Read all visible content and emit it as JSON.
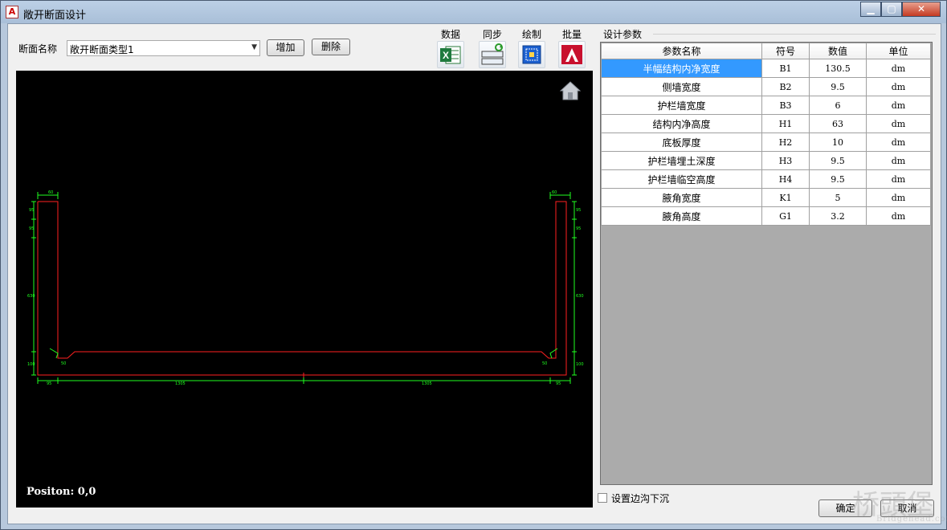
{
  "window": {
    "title": "敞开断面设计",
    "app_icon": "autocad-icon",
    "controls": {
      "minimize": "▁",
      "maximize": "▢",
      "close": "✕"
    }
  },
  "section": {
    "name_label": "断面名称",
    "selected": "敞开断面类型1",
    "add_label": "增加",
    "delete_label": "删除"
  },
  "tools": [
    {
      "label": "数据",
      "icon": "excel-icon"
    },
    {
      "label": "同步",
      "icon": "sync-icon"
    },
    {
      "label": "绘制",
      "icon": "draw-icon"
    },
    {
      "label": "批量",
      "icon": "autocad-icon"
    }
  ],
  "canvas": {
    "position_text": "Positon: 0,0",
    "home_icon": "home-icon",
    "dims": {
      "top_left": "60",
      "top_right": "60",
      "left_upper": "95",
      "left_mid": "95",
      "left_long": "630",
      "left_bottom": "100",
      "right_upper": "95",
      "right_mid": "95",
      "right_long": "630",
      "right_bottom": "100",
      "haunch_left": "50",
      "haunch_right": "50",
      "bottom_left_small": "95",
      "bottom_left_span": "1305",
      "bottom_right_span": "1305",
      "bottom_right_small": "95"
    }
  },
  "params": {
    "group_label": "设计参数",
    "columns": [
      "参数名称",
      "符号",
      "数值",
      "单位"
    ],
    "rows": [
      {
        "name": "半幅结构内净宽度",
        "symbol": "B1",
        "value": "130.5",
        "unit": "dm"
      },
      {
        "name": "侧墙宽度",
        "symbol": "B2",
        "value": "9.5",
        "unit": "dm"
      },
      {
        "name": "护栏墙宽度",
        "symbol": "B3",
        "value": "6",
        "unit": "dm"
      },
      {
        "name": "结构内净高度",
        "symbol": "H1",
        "value": "63",
        "unit": "dm"
      },
      {
        "name": "底板厚度",
        "symbol": "H2",
        "value": "10",
        "unit": "dm"
      },
      {
        "name": "护栏墙埋土深度",
        "symbol": "H3",
        "value": "9.5",
        "unit": "dm"
      },
      {
        "name": "护栏墙临空高度",
        "symbol": "H4",
        "value": "9.5",
        "unit": "dm"
      },
      {
        "name": "腋角宽度",
        "symbol": "K1",
        "value": "5",
        "unit": "dm"
      },
      {
        "name": "腋角高度",
        "symbol": "G1",
        "value": "3.2",
        "unit": "dm"
      }
    ]
  },
  "footer": {
    "checkbox_label": "设置边沟下沉",
    "ok_label": "确定",
    "cancel_label": "取消"
  },
  "watermark": {
    "text": "桥頭堡",
    "sub": "Bridgehead.com.cn"
  },
  "colors": {
    "selection": "#3399ff",
    "cad_structure": "#ff2020",
    "cad_dimension": "#20ff20"
  }
}
